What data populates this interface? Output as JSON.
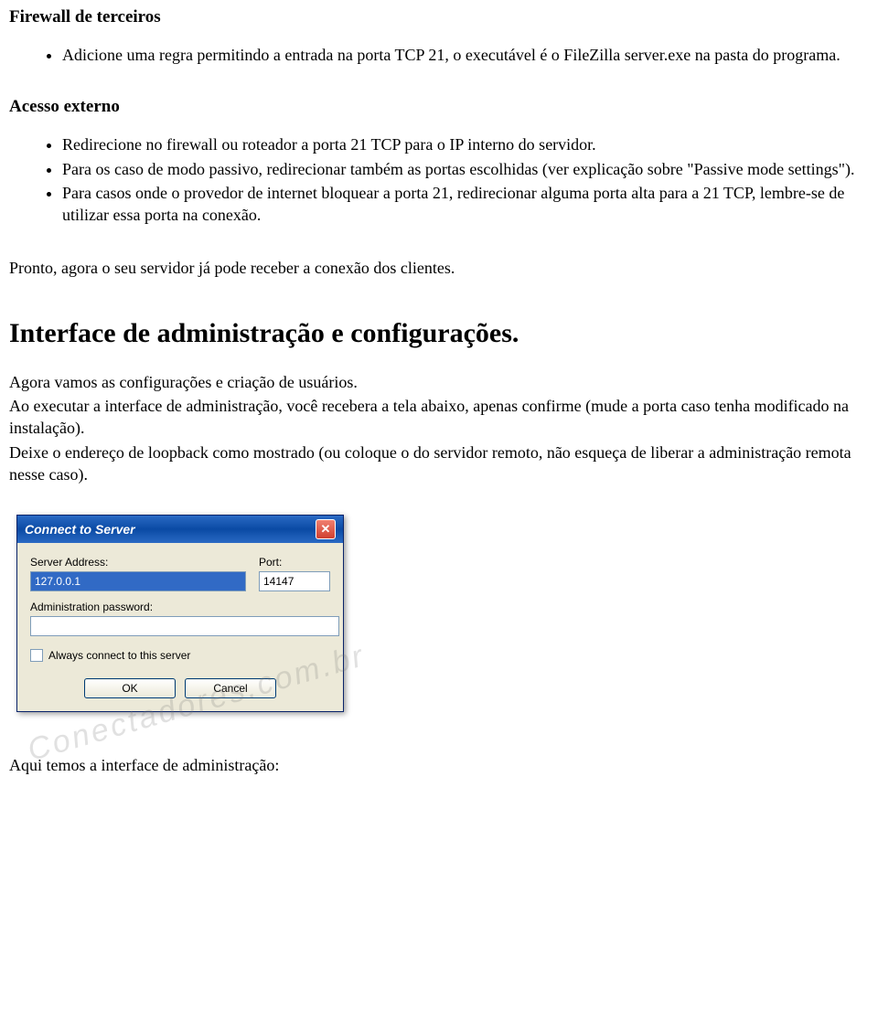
{
  "section1": {
    "heading": "Firewall de terceiros",
    "bullets": [
      "Adicione uma regra permitindo a entrada na porta TCP 21, o executável é o FileZilla server.exe na pasta do programa."
    ]
  },
  "section2": {
    "heading": "Acesso externo",
    "bullets": [
      "Redirecione no firewall ou roteador a porta 21 TCP para o IP interno do servidor.",
      "Para os caso de modo passivo, redirecionar também as portas escolhidas (ver explicação sobre \"Passive mode settings\").",
      "Para casos onde o provedor de internet bloquear a porta 21, redirecionar alguma porta alta para a 21 TCP, lembre-se de utilizar essa porta na conexão."
    ]
  },
  "para_ready": "Pronto, agora o seu servidor já pode receber a conexão dos clientes.",
  "big_heading": "Interface de administração e configurações.",
  "para_config1": "Agora vamos as configurações e criação de usuários.",
  "para_config2": "Ao executar a interface de administração, você recebera a tela abaixo, apenas confirme (mude a porta caso tenha modificado na instalação).",
  "para_config3": "Deixe o endereço de loopback como mostrado (ou coloque o do servidor remoto, não esqueça de liberar a administração remota nesse caso).",
  "dialog": {
    "title": "Connect to Server",
    "server_address_label": "Server Address:",
    "server_address_value": "127.0.0.1",
    "port_label": "Port:",
    "port_value": "14147",
    "admin_pw_label": "Administration password:",
    "admin_pw_value": "",
    "checkbox_label": "Always connect to this server",
    "ok": "OK",
    "cancel": "Cancel"
  },
  "watermark": "Conectadores.com.br",
  "para_after": "Aqui temos a interface de administração:"
}
